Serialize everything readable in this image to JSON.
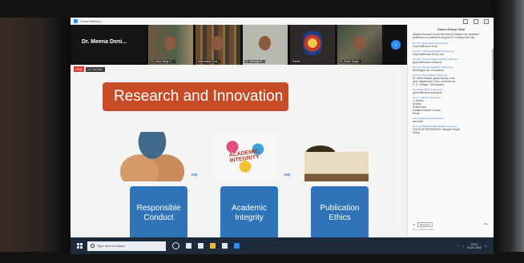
{
  "window": {
    "title": "Zoom Meeting"
  },
  "participants": [
    {
      "name": "Dr. Meena Deni...",
      "display": "name-only"
    },
    {
      "name": "Dr.Vinita Singh C..."
    },
    {
      "name": "Meenakshi Gulr..."
    },
    {
      "name": "Dr. Nirmala S..."
    },
    {
      "name": "Parikh"
    },
    {
      "name": "Dr. Amar Singh..."
    }
  ],
  "share": {
    "live": "LIVE",
    "sharing_label": "on YouTube"
  },
  "slide": {
    "title": "Research and Innovation",
    "picture_word": "ACADEMIC INTEGRITY",
    "boxes": [
      {
        "label": "Responsible\nConduct"
      },
      {
        "label": "Academic\nIntegrity"
      },
      {
        "label": "Publication\nEthics"
      }
    ]
  },
  "chat": {
    "title": "Zoom Group Chat",
    "intro": "please everyone to join the meet to Mission the assistant professor to commence at good PG College Seth Mp",
    "messages": [
      {
        "meta": "From Dr. Neelu Rawat to Everyone:",
        "text": "Good afternoon to all"
      },
      {
        "meta": "From Dr. Gurpreet Ahluwalia to Everyone:",
        "text": "Good Afternoon Every one"
      },
      {
        "meta": "From Dr. Sudha R. Raghuwanshi to Everyone:",
        "text": "good afternoon everyone"
      },
      {
        "meta": "From Dr. Deepa Choudhary to Everyone:",
        "text": "Well Begun Dr. Choudhury"
      },
      {
        "meta": "From Dr. Neelu Rawat to Everyone:",
        "text": "Dr. Neelu Rawat, guest faculty, rural\nwork department, Govt. Autonomous\nP. G. College, Chhindwara"
      },
      {
        "meta": "From Neha Singh to Everyone:",
        "text": "good afternoon everyone"
      },
      {
        "meta": "From J. Shukla to Everyone:",
        "text": "J. Shukla\nDeputy\nPolytechnic\nPatalkot Dubets Counts\nHindu"
      },
      {
        "meta": "From Shilpa Singh to Everyone:",
        "text": "well start"
      },
      {
        "meta": "From GYANPATH DAVE SINGH to Everyone:",
        "text": "GOOD AFTERNOON Dr. Manjeet Singh\nSetup"
      }
    ],
    "to_label": "To:",
    "to_value": "Everyone",
    "file_label": "File",
    "input_placeholder": "Type message here..."
  },
  "taskbar": {
    "search_placeholder": "Type here to search",
    "time": "13:01",
    "date": "16-07-2020"
  },
  "colors": {
    "slide_title_bg": "#c84a27",
    "box_bg": "#2f74b8",
    "zoom_blue": "#2d8cff",
    "live_red": "#e53935",
    "taskbar_bg": "#1d2a3a"
  }
}
